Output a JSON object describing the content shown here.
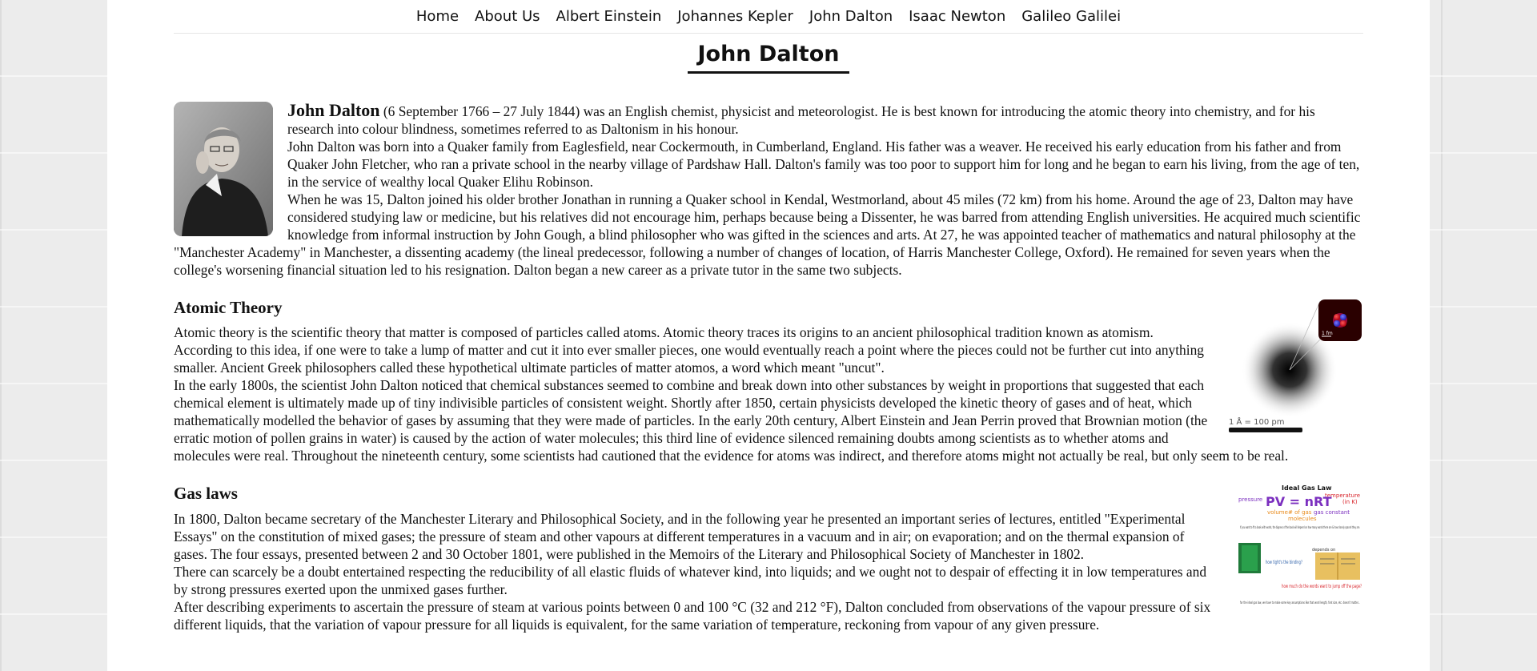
{
  "nav": {
    "items": [
      "Home",
      "About Us",
      "Albert Einstein",
      "Johannes Kepler",
      "John Dalton",
      "Isaac Newton",
      "Galileo Galilei"
    ]
  },
  "page_title": "John Dalton",
  "intro": {
    "name": "John Dalton",
    "p1_rest": " (6 September 1766 – 27 July 1844) was an English chemist, physicist and meteorologist. He is best known for introducing the atomic theory into chemistry, and for his research into colour blindness, sometimes referred to as Daltonism in his honour.",
    "p2": "John Dalton was born into a Quaker family from Eaglesfield, near Cockermouth, in Cumberland, England. His father was a weaver. He received his early education from his father and from Quaker John Fletcher, who ran a private school in the nearby village of Pardshaw Hall. Dalton's family was too poor to support him for long and he began to earn his living, from the age of ten, in the service of wealthy local Quaker Elihu Robinson.",
    "p3": "When he was 15, Dalton joined his older brother Jonathan in running a Quaker school in Kendal, Westmorland, about 45 miles (72 km) from his home. Around the age of 23, Dalton may have considered studying law or medicine, but his relatives did not encourage him, perhaps because being a Dissenter, he was barred from attending English universities. He acquired much scientific knowledge from informal instruction by John Gough, a blind philosopher who was gifted in the sciences and arts. At 27, he was appointed teacher of mathematics and natural philosophy at the \"Manchester Academy\" in Manchester, a dissenting academy (the lineal predecessor, following a number of changes of location, of Harris Manchester College, Oxford). He remained for seven years when the college's worsening financial situation led to his resignation. Dalton began a new career as a private tutor in the same two subjects."
  },
  "atomic": {
    "heading": "Atomic Theory",
    "p1": "Atomic theory is the scientific theory that matter is composed of particles called atoms. Atomic theory traces its origins to an ancient philosophical tradition known as atomism. According to this idea, if one were to take a lump of matter and cut it into ever smaller pieces, one would eventually reach a point where the pieces could not be further cut into anything smaller. Ancient Greek philosophers called these hypothetical ultimate particles of matter atomos, a word which meant \"uncut\".",
    "p2": "In the early 1800s, the scientist John Dalton noticed that chemical substances seemed to combine and break down into other substances by weight in proportions that suggested that each chemical element is ultimately made up of tiny indivisible particles of consistent weight. Shortly after 1850, certain physicists developed the kinetic theory of gases and of heat, which mathematically modelled the behavior of gases by assuming that they were made of particles. In the early 20th century, Albert Einstein and Jean Perrin proved that Brownian motion (the erratic motion of pollen grains in water) is caused by the action of water molecules; this third line of evidence silenced remaining doubts among scientists as to whether atoms and molecules were real. Throughout the nineteenth century, some scientists had cautioned that the evidence for atoms was indirect, and therefore atoms might not actually be real, but only seem to be real.",
    "figure_scale": "1 Å = 100 pm",
    "inset_scale": "1 fm"
  },
  "gas": {
    "heading": "Gas laws",
    "p1": "In 1800, Dalton became secretary of the Manchester Literary and Philosophical Society, and in the following year he presented an important series of lectures, entitled \"Experimental Essays\" on the constitution of mixed gases; the pressure of steam and other vapours at different temperatures in a vacuum and in air; on evaporation; and on the thermal expansion of gases. The four essays, presented between 2 and 30 October 1801, were published in the Memoirs of the Literary and Philosophical Society of Manchester in 1802.",
    "p2": "There can scarcely be a doubt entertained respecting the reducibility of all elastic fluids of whatever kind, into liquids; and we ought not to despair of effecting it in low temperatures and by strong pressures exerted upon the unmixed gases further.",
    "p3": "After describing experiments to ascertain the pressure of steam at various points between 0 and 100 °C (32 and 212 °F), Dalton concluded from observations of the vapour pressure of six different liquids, that the variation of vapour pressure for all liquids is equivalent, for the same variation of temperature, reckoning from vapour of any given pressure.",
    "figure": {
      "title": "Ideal Gas Law",
      "formula": "PV = nRT",
      "pressure": "pressure",
      "temperature": "temperature",
      "temp_unit": "(in K)",
      "volume": "volume",
      "moles": "# of gas",
      "gas_constant": "gas constant",
      "molecules": "molecules",
      "analogy": "If you want to fit a book with words, the bigness of the book will depend on how many words there are & how closely spaced they are.",
      "depends_on": "depends on",
      "binding": "how tight's the binding?",
      "jump": "how much do the words want to jump off the page?",
      "footer": "for the ideal gas law, we have to make some key assumptions like that word length, font size, etc. doesn't matter..."
    }
  },
  "colors": {
    "page_bg": "#ffffff",
    "text": "#111111",
    "outer_bg": "#ececec",
    "formula_green": "#2e8b57",
    "formula_purple": "#7b2fbf",
    "formula_orange": "#e88a1a",
    "formula_red": "#d8232a"
  }
}
